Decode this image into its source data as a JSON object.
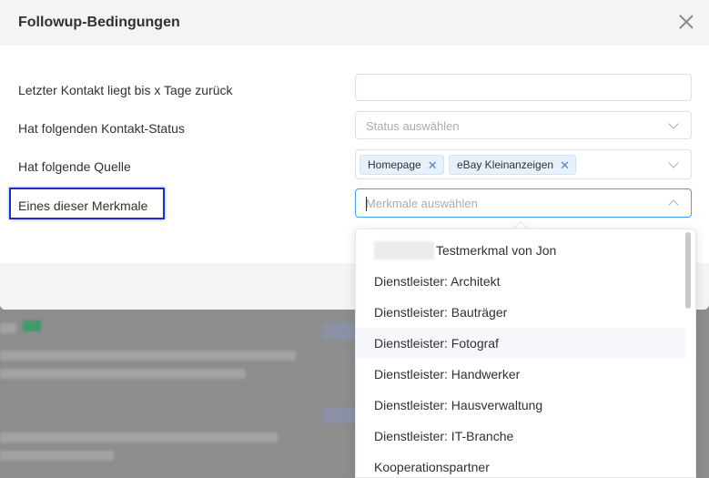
{
  "dialog": {
    "title": "Followup-Bedingungen"
  },
  "form": {
    "last_contact": {
      "label": "Letzter Kontakt liegt bis x Tage zurück",
      "value": ""
    },
    "contact_status": {
      "label": "Hat folgenden Kontakt-Status",
      "placeholder": "Status auswählen"
    },
    "source": {
      "label": "Hat folgende Quelle",
      "tags": [
        "Homepage",
        "eBay Kleinanzeigen"
      ]
    },
    "features": {
      "label": "Eines dieser Merkmale",
      "placeholder": "Merkmale auswählen"
    }
  },
  "dropdown": {
    "options": [
      "Testmerkmal von Jon",
      "Dienstleister: Architekt",
      "Dienstleister: Bauträger",
      "Dienstleister: Fotograf",
      "Dienstleister: Handwerker",
      "Dienstleister: Hausverwaltung",
      "Dienstleister: IT-Branche",
      "Kooperationspartner"
    ],
    "hovered": "Dienstleister: Fotograf"
  },
  "icons": {
    "close": "close-icon",
    "chevron_down": "chevron-down-icon",
    "chevron_up": "chevron-up-icon",
    "tag_remove": "x-icon"
  },
  "colors": {
    "highlight_box": "#1a2fc8",
    "tag_bg": "#e8f0fc",
    "focus_border": "#409eff"
  }
}
